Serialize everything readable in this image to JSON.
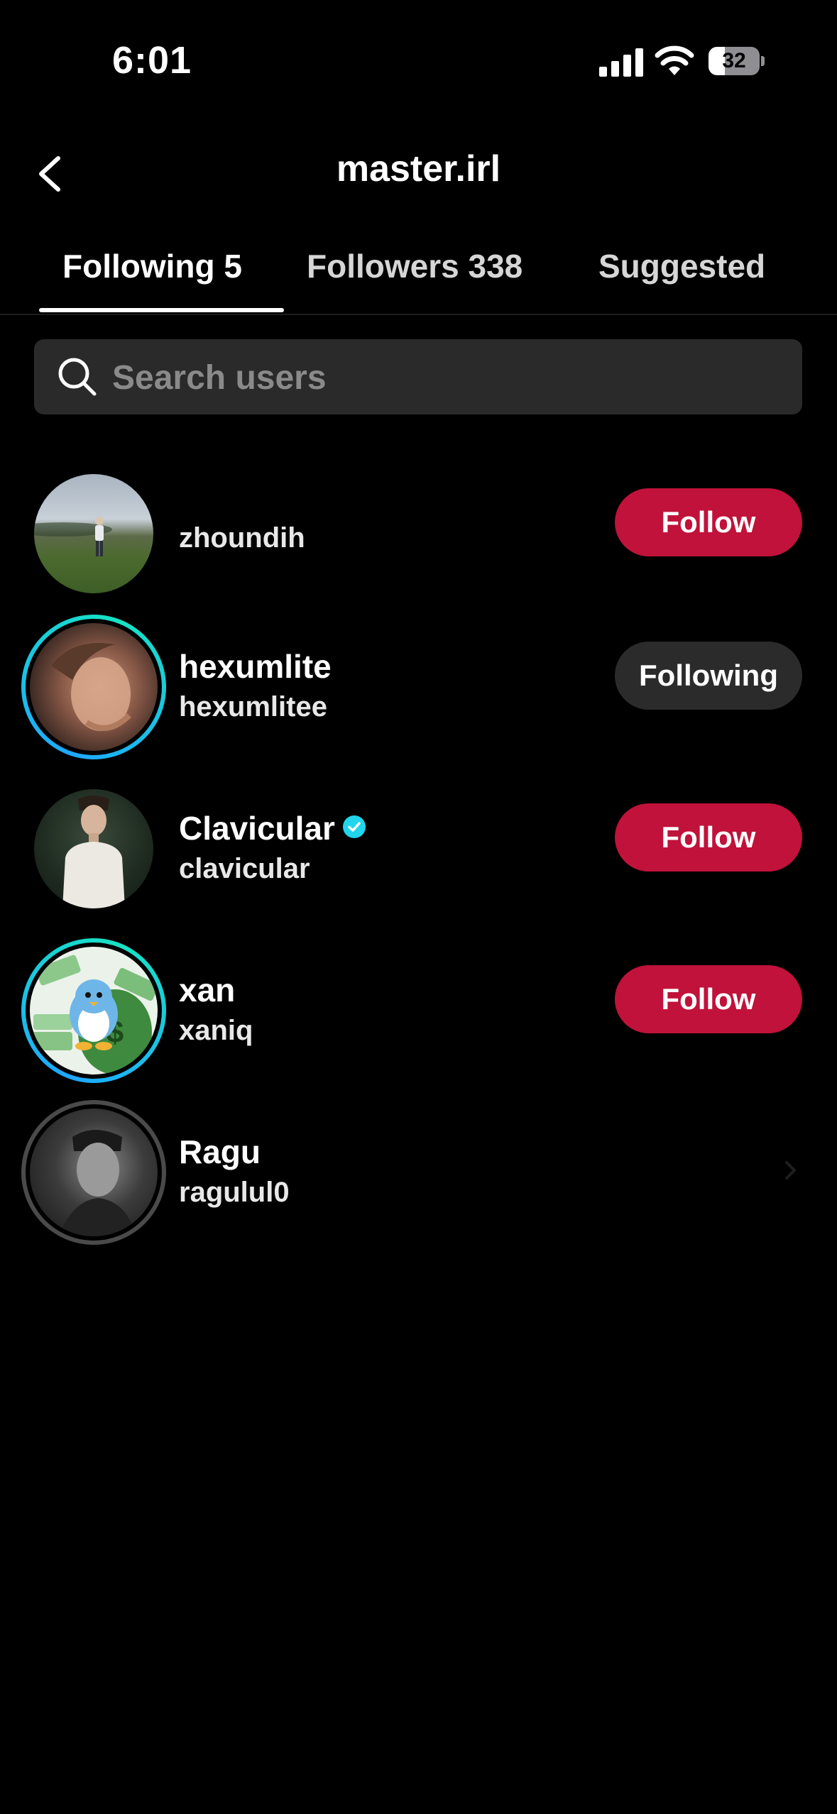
{
  "status_bar": {
    "time": "6:01",
    "battery": "32",
    "battery_level": 0.32
  },
  "header": {
    "title": "master.irl"
  },
  "tabs": [
    {
      "label": "Following 5",
      "active": true
    },
    {
      "label": "Followers 338",
      "active": false
    },
    {
      "label": "Suggested",
      "active": false
    }
  ],
  "search": {
    "placeholder": "Search users",
    "value": ""
  },
  "users": [
    {
      "display_name": "",
      "username": "zhoundih",
      "button": "Follow",
      "verified": false
    },
    {
      "display_name": "hexumlite",
      "username": "hexumlitee",
      "button": "Following",
      "verified": false
    },
    {
      "display_name": "Clavicular",
      "username": "clavicular",
      "button": "Follow",
      "verified": true
    },
    {
      "display_name": "xan",
      "username": "xaniq",
      "button": "Follow",
      "verified": false
    },
    {
      "display_name": "Ragu",
      "username": "ragulul0",
      "button": "",
      "verified": false
    }
  ],
  "colors": {
    "follow_button": "#c0123a",
    "following_button": "#2b2b2b",
    "story_ring_start": "#1ea7ff",
    "story_ring_end": "#17e3c3",
    "verified_badge": "#20d5ec"
  }
}
